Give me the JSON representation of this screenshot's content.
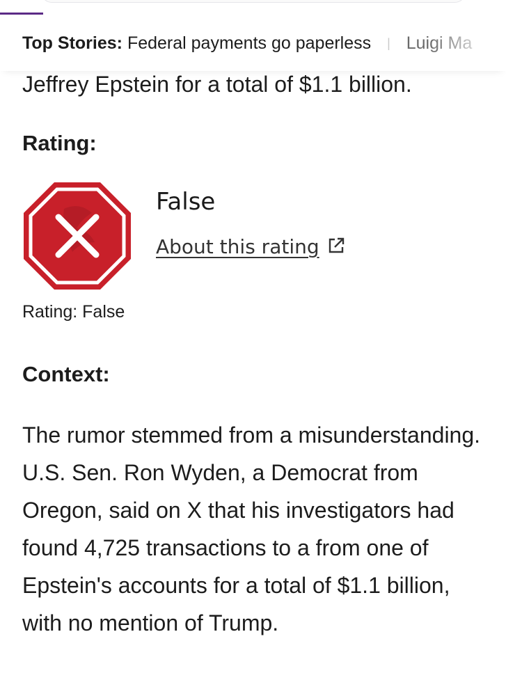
{
  "top_bar": {
    "label": "Top Stories:",
    "story_1": "Federal payments go paperless",
    "separator": "|",
    "story_2": "Luigi Ma"
  },
  "article": {
    "lead_tail": "Jeffrey Epstein for a total of $1.1 billion.",
    "rating_heading": "Rating:",
    "rating": {
      "icon": "false-stop-sign-icon",
      "verdict": "False",
      "about_link": "About this rating",
      "caption": "Rating: False"
    },
    "context_heading": "Context:",
    "context_body": "The rumor stemmed from a misunderstanding. U.S. Sen. Ron Wyden, a Democrat from Oregon, said on X that his investigators had found 4,725 transactions to a from one of Epstein's accounts for a total of $1.1 billion, with no mention of Trump."
  },
  "colors": {
    "accent": "#5b2a86",
    "stop_red": "#c8202a"
  }
}
